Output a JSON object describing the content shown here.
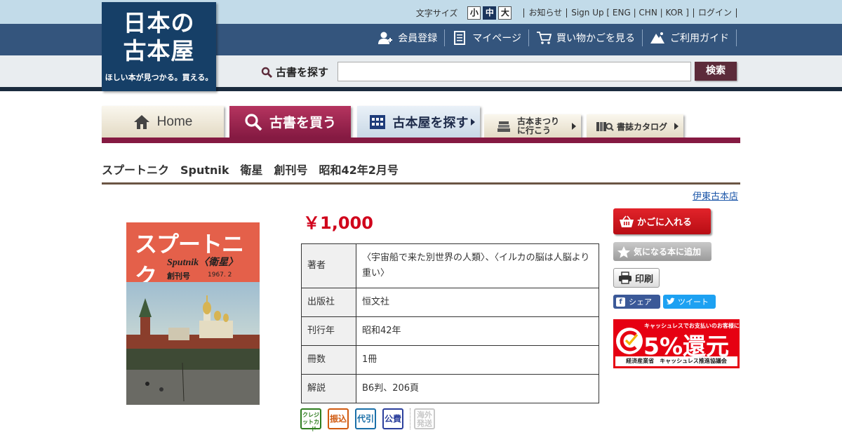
{
  "logo": {
    "line1": "日本の",
    "line2": "古本屋",
    "tagline": "ほしい本が見つかる。買える。"
  },
  "util": {
    "font_size_label": "文字サイズ",
    "font_sizes": [
      "小",
      "中",
      "大"
    ],
    "links": [
      "お知らせ",
      "Sign Up [ ENG | CHN | KOR ]",
      "ログイン"
    ]
  },
  "nav": {
    "register": "会員登録",
    "mypage": "マイページ",
    "cart": "買い物かごを見る",
    "guide": "ご利用ガイド"
  },
  "search": {
    "label": "古書を探す",
    "placeholder": "",
    "button": "検索"
  },
  "tabs": {
    "home": "Home",
    "buy": "古書を買う",
    "shop": "古本屋を探す",
    "fair_line1": "古本まつり",
    "fair_line2": "に行こう",
    "catalog": "書誌カタログ"
  },
  "product": {
    "title": "スプートニク　Sputnik　衛星　創刊号　昭和42年2月号",
    "store": "伊東古本店",
    "price": "￥1,000",
    "cover": {
      "title_jp": "スプートニク",
      "title_en": "Sputnik〈衛星〉",
      "issue": "創刊号",
      "date": "1967. 2"
    },
    "specs": [
      {
        "key": "著者",
        "value": "〈宇宙船で来た別世界の人類〉、〈イルカの脳は人脳より重い〉"
      },
      {
        "key": "出版社",
        "value": "恒文社"
      },
      {
        "key": "刊行年",
        "value": "昭和42年"
      },
      {
        "key": "冊数",
        "value": "1冊"
      },
      {
        "key": "解説",
        "value": "B6判、206頁"
      }
    ],
    "payments": [
      {
        "label": "クレジットカード",
        "color": "#2e7d1f"
      },
      {
        "label": "振込",
        "color": "#d05a10"
      },
      {
        "label": "代引",
        "color": "#1a6fa8"
      },
      {
        "label": "公費",
        "color": "#2b3f9c"
      },
      {
        "label": "海外発送",
        "color": "#c8c8c8"
      }
    ]
  },
  "actions": {
    "cart": "かごに入れる",
    "favorite": "気になる本に追加",
    "print": "印刷",
    "share": "シェア",
    "tweet": "ツイート"
  },
  "cashless": {
    "caption": "キャッシュレスでお支払いのお客様に",
    "headline": "5%還元",
    "footer": "経済産業省　キャッシュレス推進協議会"
  },
  "colors": {
    "header_dark": "#34557d",
    "accent_wine": "#851a42",
    "price_red": "#d0021b",
    "link_blue": "#1a55a8"
  }
}
